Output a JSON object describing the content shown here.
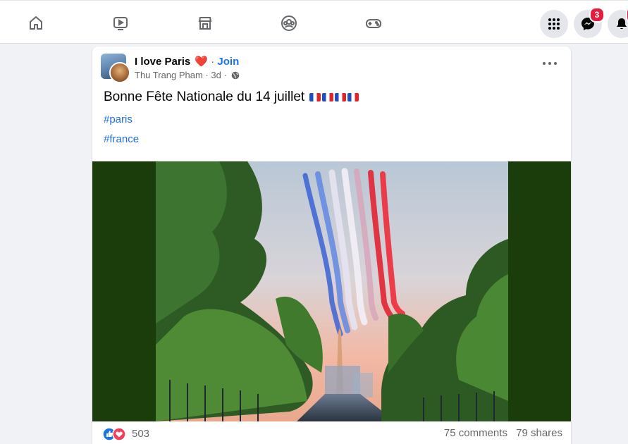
{
  "nav": {
    "icons": [
      "home-icon",
      "watch-icon",
      "marketplace-icon",
      "groups-icon",
      "gaming-icon"
    ],
    "right": {
      "menu_icon": "grid-menu-icon",
      "messenger_icon": "messenger-icon",
      "messenger_badge": "3",
      "notifications_icon": "bell-icon"
    }
  },
  "post": {
    "group_name": "I love Paris",
    "heart": "❤️",
    "join_label": "Join",
    "author": "Thu Trang Pham",
    "time": "3d",
    "privacy_icon": "globe-icon",
    "more_icon": "more-options-icon",
    "text": "Bonne Fête Nationale du 14 juillet",
    "hashtags": [
      "#paris",
      "#france"
    ],
    "reactions": {
      "count": "503",
      "types": [
        "like",
        "love"
      ]
    },
    "comments": "75 comments",
    "shares": "79 shares"
  },
  "colors": {
    "accent": "#1b74e4",
    "badge": "#e41e3f",
    "media_bg": "#1b3d0c"
  }
}
